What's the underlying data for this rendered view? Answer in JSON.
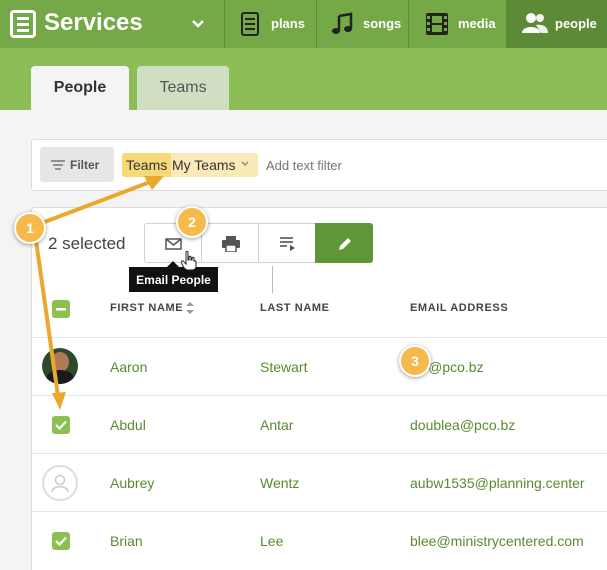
{
  "app": {
    "title": "Services"
  },
  "nav": {
    "tabs": [
      {
        "label": "plans",
        "icon": "plans-icon"
      },
      {
        "label": "songs",
        "icon": "music-note-icon"
      },
      {
        "label": "media",
        "icon": "film-icon"
      },
      {
        "label": "people",
        "icon": "people-icon",
        "active": true
      }
    ]
  },
  "subtabs": [
    {
      "label": "People",
      "active": true
    },
    {
      "label": "Teams",
      "active": false
    }
  ],
  "filter": {
    "button_label": "Filter",
    "chip_key": "Teams",
    "chip_value": "My Teams",
    "text_placeholder": "Add text filter"
  },
  "selection": {
    "count_label": "2 selected",
    "tooltip": "Email People",
    "actions": [
      "mail-icon",
      "printer-icon",
      "sort-list-icon",
      "pencil-icon"
    ]
  },
  "table": {
    "columns": [
      "FIRST NAME",
      "LAST NAME",
      "EMAIL ADDRESS"
    ],
    "rows": [
      {
        "first": "Aaron",
        "last": "Stewart",
        "email": "w@pco.bz",
        "selected": false,
        "avatar": "photo"
      },
      {
        "first": "Abdul",
        "last": "Antar",
        "email": "doublea@pco.bz",
        "selected": true,
        "avatar": "none"
      },
      {
        "first": "Aubrey",
        "last": "Wentz",
        "email": "aubw1535@planning.center",
        "selected": false,
        "avatar": "placeholder"
      },
      {
        "first": "Brian",
        "last": "Lee",
        "email": "blee@ministrycentered.com",
        "selected": true,
        "avatar": "none"
      }
    ]
  },
  "annotations": {
    "markers": [
      "1",
      "2",
      "3"
    ]
  },
  "colors": {
    "primary": "#75a846",
    "accent": "#5f9636",
    "highlight": "#f6b94b"
  }
}
